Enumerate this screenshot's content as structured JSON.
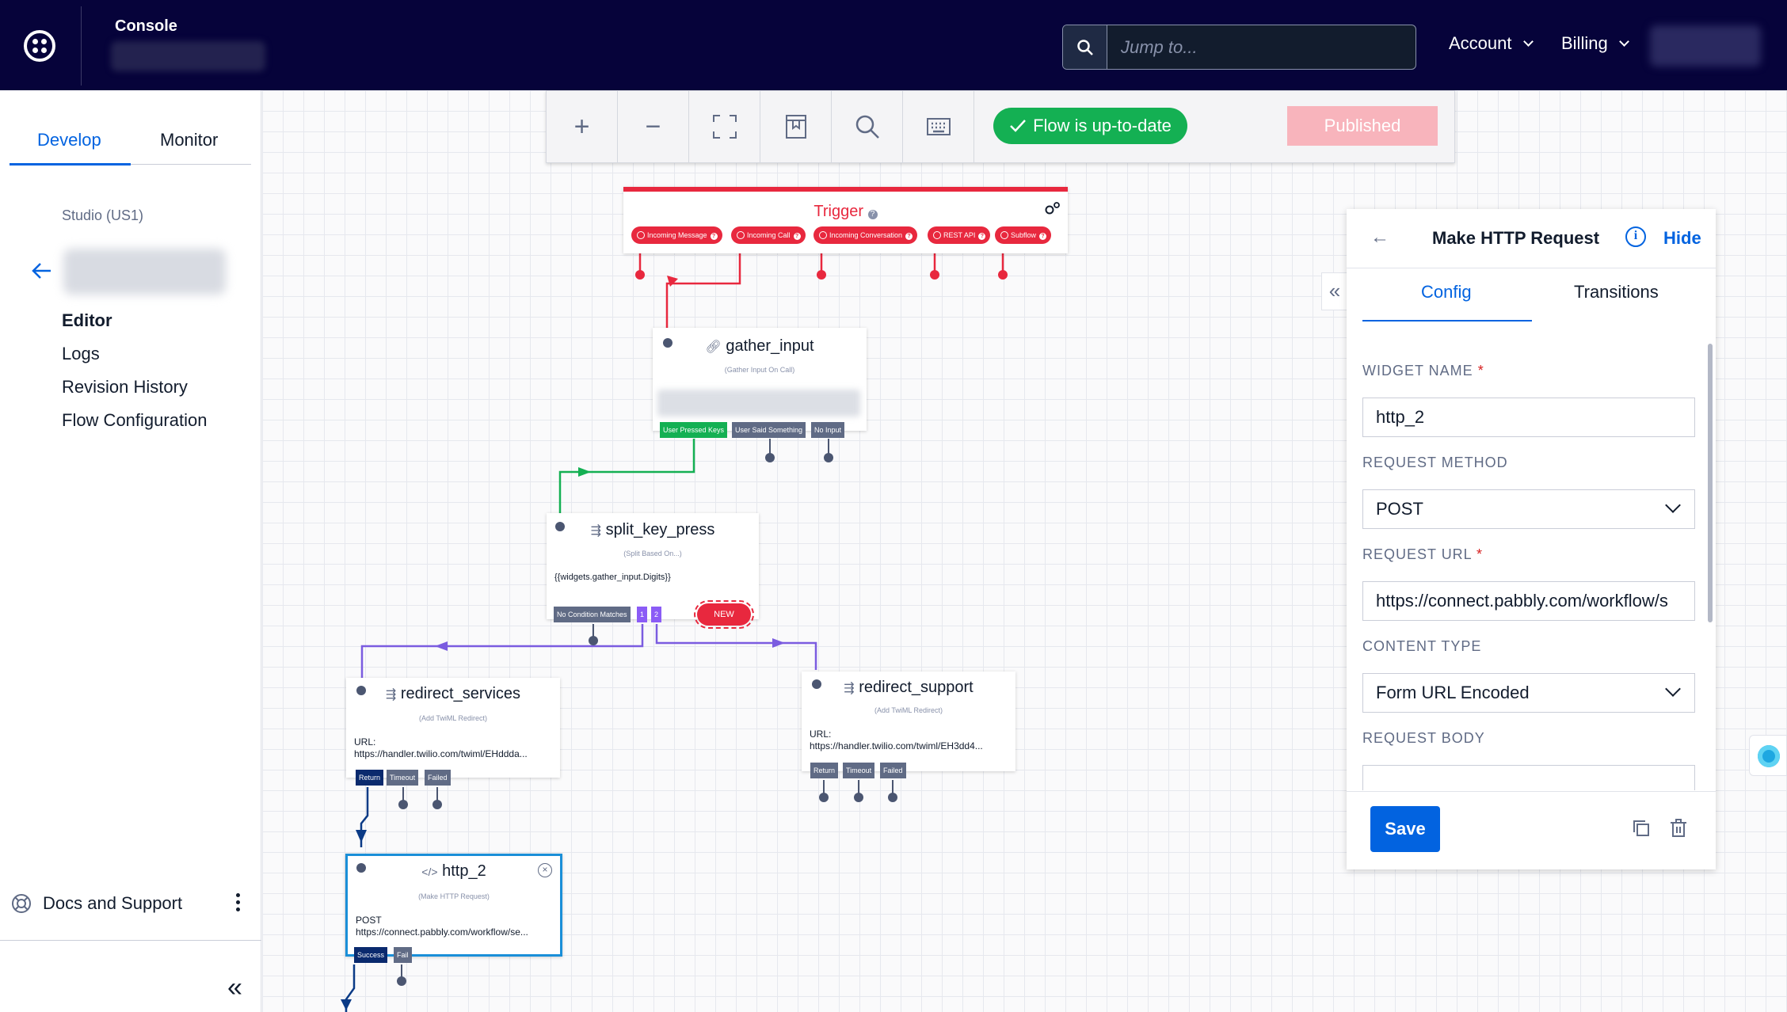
{
  "header": {
    "console_label": "Console",
    "search_placeholder": "Jump to...",
    "account_label": "Account",
    "billing_label": "Billing"
  },
  "sidebar": {
    "tabs": [
      {
        "label": "Develop",
        "active": true
      },
      {
        "label": "Monitor",
        "active": false
      }
    ],
    "studio_label": "Studio (US1)",
    "nav": [
      {
        "label": "Editor",
        "active": true
      },
      {
        "label": "Logs",
        "active": false
      },
      {
        "label": "Revision History",
        "active": false
      },
      {
        "label": "Flow Configuration",
        "active": false
      }
    ],
    "docs_label": "Docs and Support"
  },
  "toolbar": {
    "status_label": "Flow is up-to-date",
    "publish_label": "Published"
  },
  "canvas": {
    "trigger": {
      "title": "Trigger",
      "outputs": [
        "Incoming Message",
        "Incoming Call",
        "Incoming Conversation",
        "REST API",
        "Subflow"
      ]
    },
    "gather_input": {
      "name": "gather_input",
      "type": "(Gather Input On Call)",
      "outputs": [
        "User Pressed Keys",
        "User Said Something",
        "No Input"
      ]
    },
    "split_key_press": {
      "name": "split_key_press",
      "type": "(Split Based On...)",
      "body": "{{widgets.gather_input.Digits}}",
      "outputs": [
        "No Condition Matches",
        "1",
        "2"
      ],
      "new_badge": "NEW"
    },
    "redirect_services": {
      "name": "redirect_services",
      "type": "(Add TwiML Redirect)",
      "url_label": "URL:",
      "url": "https://handler.twilio.com/twiml/EHddda...",
      "outputs": [
        "Return",
        "Timeout",
        "Failed"
      ]
    },
    "redirect_support": {
      "name": "redirect_support",
      "type": "(Add TwiML Redirect)",
      "url_label": "URL:",
      "url": "https://handler.twilio.com/twiml/EH3dd4...",
      "outputs": [
        "Return",
        "Timeout",
        "Failed"
      ]
    },
    "http_2": {
      "name": "http_2",
      "type": "(Make HTTP Request)",
      "method": "POST",
      "url": "https://connect.pabbly.com/workflow/se...",
      "outputs": [
        "Success",
        "Fail"
      ]
    }
  },
  "panel": {
    "title": "Make HTTP Request",
    "hide_label": "Hide",
    "tabs": [
      {
        "label": "Config",
        "active": true
      },
      {
        "label": "Transitions",
        "active": false
      }
    ],
    "widget_name_label": "WIDGET NAME",
    "widget_name_value": "http_2",
    "request_method_label": "REQUEST METHOD",
    "request_method_value": "POST",
    "request_url_label": "REQUEST URL",
    "request_url_value": "https://connect.pabbly.com/workflow/s",
    "content_type_label": "CONTENT TYPE",
    "content_type_value": "Form URL Encoded",
    "request_body_label": "REQUEST BODY",
    "required_mark": "*",
    "save_label": "Save"
  },
  "colors": {
    "topbar": "#06033a",
    "accent": "#0263e0",
    "success": "#14b053",
    "trigger": "#e8283e",
    "branch": "#7b5ce0",
    "navy": "#0a3a86"
  },
  "icons": [
    "twilio-logo-icon",
    "search-icon",
    "chevron-down-icon",
    "arrow-left-icon",
    "zoom-in-icon",
    "zoom-out-icon",
    "fullscreen-icon",
    "notes-icon",
    "magnifier-icon",
    "keyboard-icon",
    "check-icon",
    "gear-icon",
    "link-icon",
    "split-icon",
    "code-icon",
    "info-icon",
    "copy-icon",
    "trash-icon",
    "lifebuoy-icon",
    "double-chevron-left-icon"
  ]
}
